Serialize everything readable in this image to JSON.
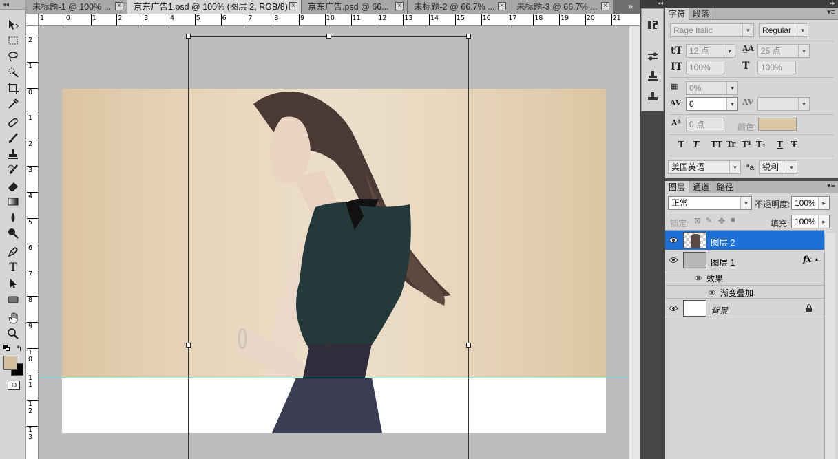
{
  "tabs": [
    {
      "label": "未标题-1 @ 100% ..."
    },
    {
      "label": "京东广告1.psd @ 100% (图层 2, RGB/8) *"
    },
    {
      "label": "京东广告.psd @ 66..."
    },
    {
      "label": "未标题-2 @ 66.7% ..."
    },
    {
      "label": "未标题-3 @ 66.7% ..."
    }
  ],
  "ruler": {
    "top": [
      "1",
      "0",
      "1",
      "2",
      "3",
      "4",
      "5",
      "6",
      "7",
      "8",
      "9",
      "10",
      "11",
      "12",
      "13",
      "14",
      "15",
      "16",
      "17",
      "18",
      "19",
      "20",
      "21"
    ],
    "left": [
      "2",
      "1",
      "0",
      "1",
      "2",
      "3",
      "4",
      "5",
      "6",
      "7",
      "8",
      "9",
      "1 0",
      "1 1",
      "1 2",
      "1 3"
    ]
  },
  "tools": [
    "move-tool",
    "marquee-tool",
    "lasso-tool",
    "quick-select-tool",
    "crop-tool",
    "eyedropper-tool",
    "healing-tool",
    "brush-tool",
    "stamp-tool",
    "history-brush-tool",
    "eraser-tool",
    "gradient-tool",
    "blur-tool",
    "dodge-tool",
    "pen-tool",
    "type-tool",
    "path-select-tool",
    "shape-tool",
    "hand-tool",
    "zoom-tool"
  ],
  "colors": {
    "foreground": "#d6bf9b",
    "background": "#000000",
    "text_color_swatch": "#dcc7a5",
    "selected_layer": "#1e6fd6"
  },
  "character": {
    "tabs": [
      "字符",
      "段落"
    ],
    "font_family": "Rage Italic",
    "font_style": "Regular",
    "font_size": "12 点",
    "leading": "25 点",
    "vertical_scale": "100%",
    "horizontal_scale": "100%",
    "tsume": "0%",
    "kerning": "0",
    "tracking": "",
    "baseline_shift": "0 点",
    "color_label": "颜色:",
    "format_buttons": [
      "T",
      "T",
      "TT",
      "Tr",
      "T¹",
      "T₁",
      "T",
      "Ŧ"
    ],
    "language": "美国英语",
    "aa_icon": "ªa",
    "antialias": "锐利"
  },
  "layers": {
    "tabs": [
      "图层",
      "通道",
      "路径"
    ],
    "blend_mode": "正常",
    "opacity_label": "不透明度:",
    "opacity": "100%",
    "lock_label": "锁定:",
    "fill_label": "填充:",
    "fill": "100%",
    "items": [
      {
        "name": "图层 2"
      },
      {
        "name": "图层 1",
        "fx": "fx"
      },
      {
        "name": "效果"
      },
      {
        "name": "渐变叠加"
      },
      {
        "name": "背景"
      }
    ]
  }
}
